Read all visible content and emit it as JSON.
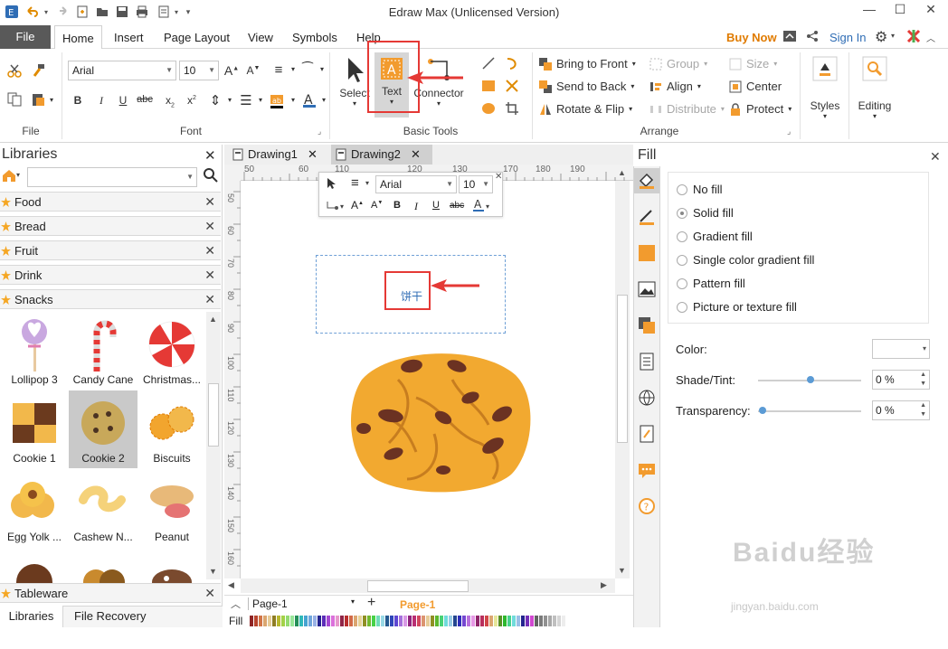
{
  "app": {
    "title": "Edraw Max (Unlicensed Version)"
  },
  "menu": {
    "file": "File",
    "tabs": [
      "Home",
      "Insert",
      "Page Layout",
      "View",
      "Symbols",
      "Help"
    ],
    "buy_now": "Buy Now",
    "sign_in": "Sign In"
  },
  "ribbon": {
    "groups": {
      "file": "File",
      "font": "Font",
      "basic_tools": "Basic Tools",
      "arrange": "Arrange"
    },
    "font_name": "Arial",
    "font_size": "10",
    "tools": {
      "select": "Select",
      "text": "Text",
      "connector": "Connector"
    },
    "arrange": {
      "bring_to_front": "Bring to Front",
      "send_to_back": "Send to Back",
      "rotate_flip": "Rotate & Flip",
      "group": "Group",
      "align": "Align",
      "distribute": "Distribute",
      "size": "Size",
      "center": "Center",
      "protect": "Protect"
    },
    "styles": "Styles",
    "editing": "Editing"
  },
  "libraries": {
    "title": "Libraries",
    "search_placeholder": "",
    "categories": [
      "Food",
      "Bread",
      "Fruit",
      "Drink",
      "Snacks"
    ],
    "shapes": [
      "Lollipop 3",
      "Candy Cane",
      "Christmas...",
      "Cookie 1",
      "Cookie 2",
      "Biscuits",
      "Egg Yolk ...",
      "Cashew N...",
      "Peanut"
    ],
    "tableware": "Tableware",
    "bottom_tabs": [
      "Libraries",
      "File Recovery"
    ]
  },
  "documents": {
    "tabs": [
      "Drawing1",
      "Drawing2"
    ],
    "ruler_h": [
      "50",
      "60",
      "110",
      "120",
      "130",
      "170",
      "180",
      "190"
    ],
    "ruler_v": [
      "50",
      "60",
      "70",
      "80",
      "90",
      "100",
      "110",
      "120",
      "130",
      "140",
      "150",
      "160"
    ],
    "mini_font": "Arial",
    "mini_size": "10",
    "text_content": "饼干",
    "page_tab": "Page-1",
    "page_tab_active": "Page-1",
    "fill_label": "Fill"
  },
  "fill_panel": {
    "title": "Fill",
    "options": [
      "No fill",
      "Solid fill",
      "Gradient fill",
      "Single color gradient fill",
      "Pattern fill",
      "Picture or texture fill"
    ],
    "selected_index": 1,
    "color_label": "Color:",
    "shade_label": "Shade/Tint:",
    "shade_value": "0 %",
    "transparency_label": "Transparency:",
    "transparency_value": "0 %"
  },
  "watermark": {
    "brand": "Baidu经验",
    "url": "jingyan.baidu.com"
  },
  "colors": {
    "accent": "#f29b2e",
    "red_highlight": "#e53935",
    "file_tab": "#595959",
    "buy_now": "#e07b00"
  }
}
